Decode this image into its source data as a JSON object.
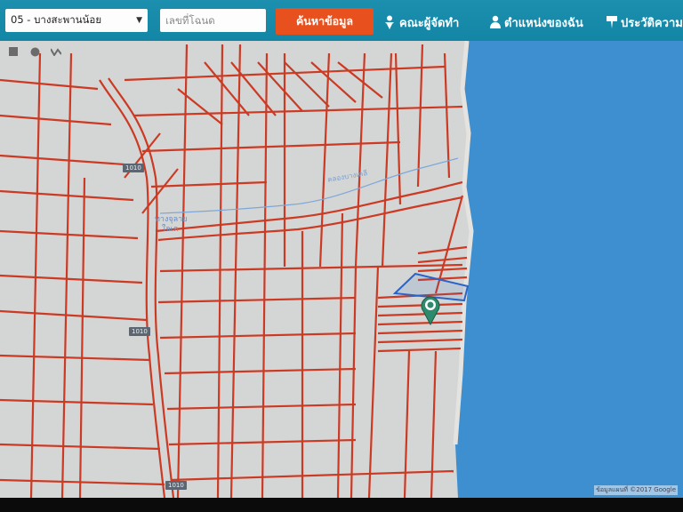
{
  "toolbar": {
    "district_select": {
      "value": "05 - บางสะพานน้อย"
    },
    "deed_input": {
      "placeholder": "เลขที่โฉนด"
    },
    "search_button": {
      "label": "ค้นหาข้อมูล"
    },
    "nav": [
      {
        "label": "คณะผู้จัดทำ",
        "icon": "person-tie-icon"
      },
      {
        "label": "ตำแหน่งของฉัน",
        "icon": "person-icon"
      },
      {
        "label": "ประวัติความ",
        "icon": "tooltip-icon"
      }
    ],
    "colors": {
      "bar": "#1a8aab",
      "search_button": "#e8501e"
    }
  },
  "map": {
    "controls": [
      "square-draw-icon",
      "circle-draw-icon",
      "polyline-draw-icon"
    ],
    "road_labels": [
      "1010",
      "1010",
      "1010"
    ],
    "place_label": [
      "ทางจุลาย",
      "ใจเด"
    ],
    "canal_label": "คลองบางเคลี",
    "attribution": "ข้อมูลแผนที่ ©2017 Google",
    "colors": {
      "land": "#d3d6d5",
      "parcel_line": "#cc3a24",
      "sea": "#3e8fcf",
      "highlight": "#2a63c9",
      "marker": "#2d8a6c"
    }
  }
}
